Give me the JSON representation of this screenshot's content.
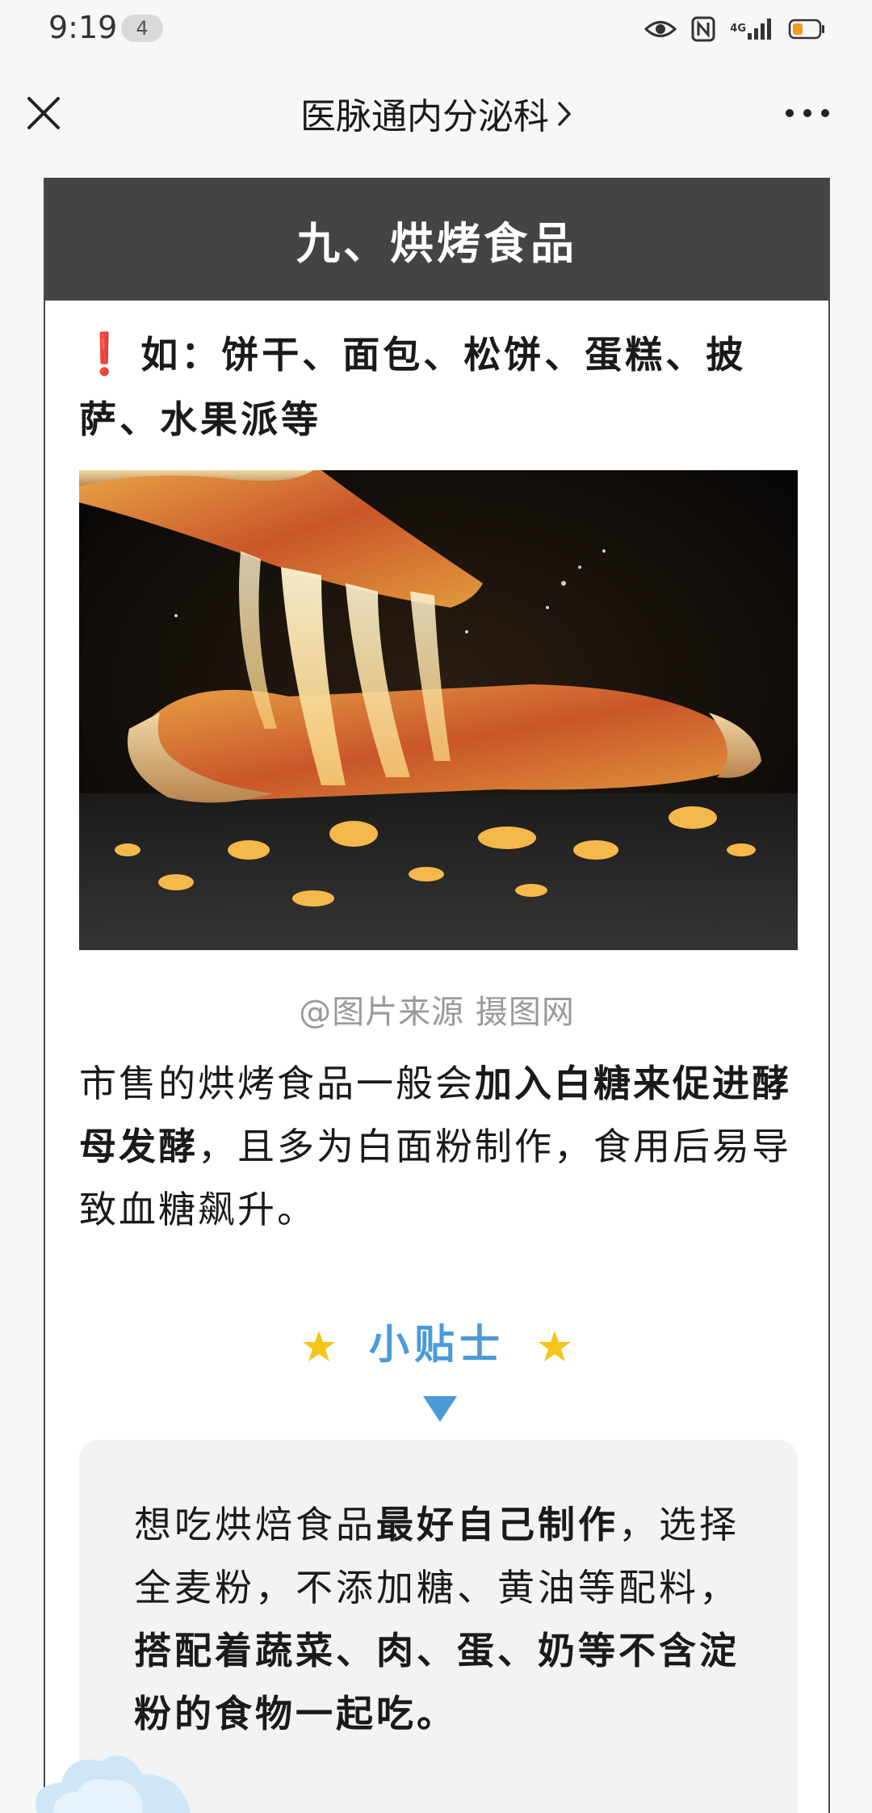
{
  "status": {
    "time": "9:19",
    "badge": "4",
    "network": "4G"
  },
  "nav": {
    "title": "医脉通内分泌科",
    "close_icon": "close-icon",
    "more_icon": "more-icon"
  },
  "section": {
    "title": "九、烘烤食品"
  },
  "examples": {
    "mark": "❗",
    "text": "如：饼干、面包、松饼、蛋糕、披萨、水果派等"
  },
  "image": {
    "caption": "@图片来源 摄图网"
  },
  "body": {
    "p1_a": "市售的烘烤食品一般会",
    "p1_b": "加入白糖来促进酵母发酵",
    "p1_c": "，且多为白面粉制作，食用后易导致血糖飙升。"
  },
  "tips": {
    "title": "小贴士",
    "t1": "想吃烘焙食品",
    "t2": "最好自己制作",
    "t3": "，选择全麦粉，不添加糖、黄油等配料，",
    "t4": "搭配着蔬菜、肉、蛋、奶等不含淀粉的食物一起吃。"
  },
  "colors": {
    "header_bg": "#444444",
    "accent_blue": "#4a9bd8",
    "star_yellow": "#f5c518",
    "alert_red": "#e02b1f"
  }
}
